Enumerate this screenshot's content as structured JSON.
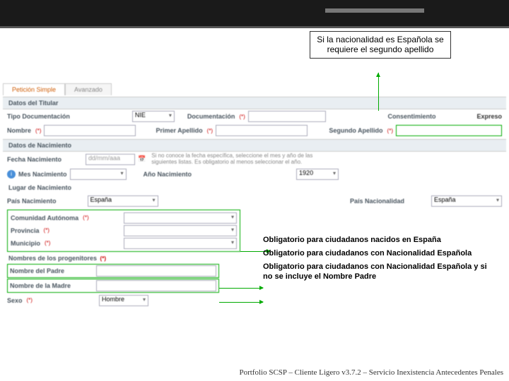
{
  "callout_top": "Si la nacionalidad es Española se requiere el segundo apellido",
  "tabs": {
    "simple": "Petición Simple",
    "avanzado": "Avanzado"
  },
  "sections": {
    "titular": "Datos del Titular",
    "nacimiento": "Datos de Nacimiento",
    "lugar": "Lugar de Nacimiento",
    "progenitores": "Nombres de los progenitores"
  },
  "labels": {
    "tipo_doc": "Tipo Documentación",
    "documentacion": "Documentación",
    "consentimiento": "Consentimiento",
    "expreso": "Expreso",
    "nombre": "Nombre",
    "apellido1": "Primer Apellido",
    "apellido2": "Segundo Apellido",
    "fecha_nac": "Fecha Nacimiento",
    "mes_nac": "Mes Nacimiento",
    "ano_nac": "Año Nacimiento",
    "pais_nac": "País Nacimiento",
    "pais_nacion": "País Nacionalidad",
    "comunidad": "Comunidad Autónoma",
    "provincia": "Provincia",
    "municipio": "Municipio",
    "nombre_padre": "Nombre del Padre",
    "nombre_madre": "Nombre de la Madre",
    "sexo": "Sexo"
  },
  "values": {
    "tipo_doc": "NIE",
    "ano_nac": "1920",
    "pais_nac": "España",
    "pais_nacion": "España",
    "sexo": "Hombre"
  },
  "placeholders": {
    "fecha": "dd/mm/aaa"
  },
  "hints": {
    "fecha": "Si no conoce la fecha específica, seleccione el mes y año de las siguientes listas. Es obligatorio al menos seleccionar el año."
  },
  "callouts_right": {
    "c1": "Obligatorio para ciudadanos nacidos en España",
    "c2": "Obligatorio para ciudadanos con Nacionalidad Española",
    "c3": "Obligatorio para ciudadanos con Nacionalidad Española y si no se incluye el Nombre Padre"
  },
  "footer": "Portfolio SCSP – Cliente Ligero v3.7.2 – Servicio Inexistencia Antecedentes Penales",
  "req": "(*)"
}
